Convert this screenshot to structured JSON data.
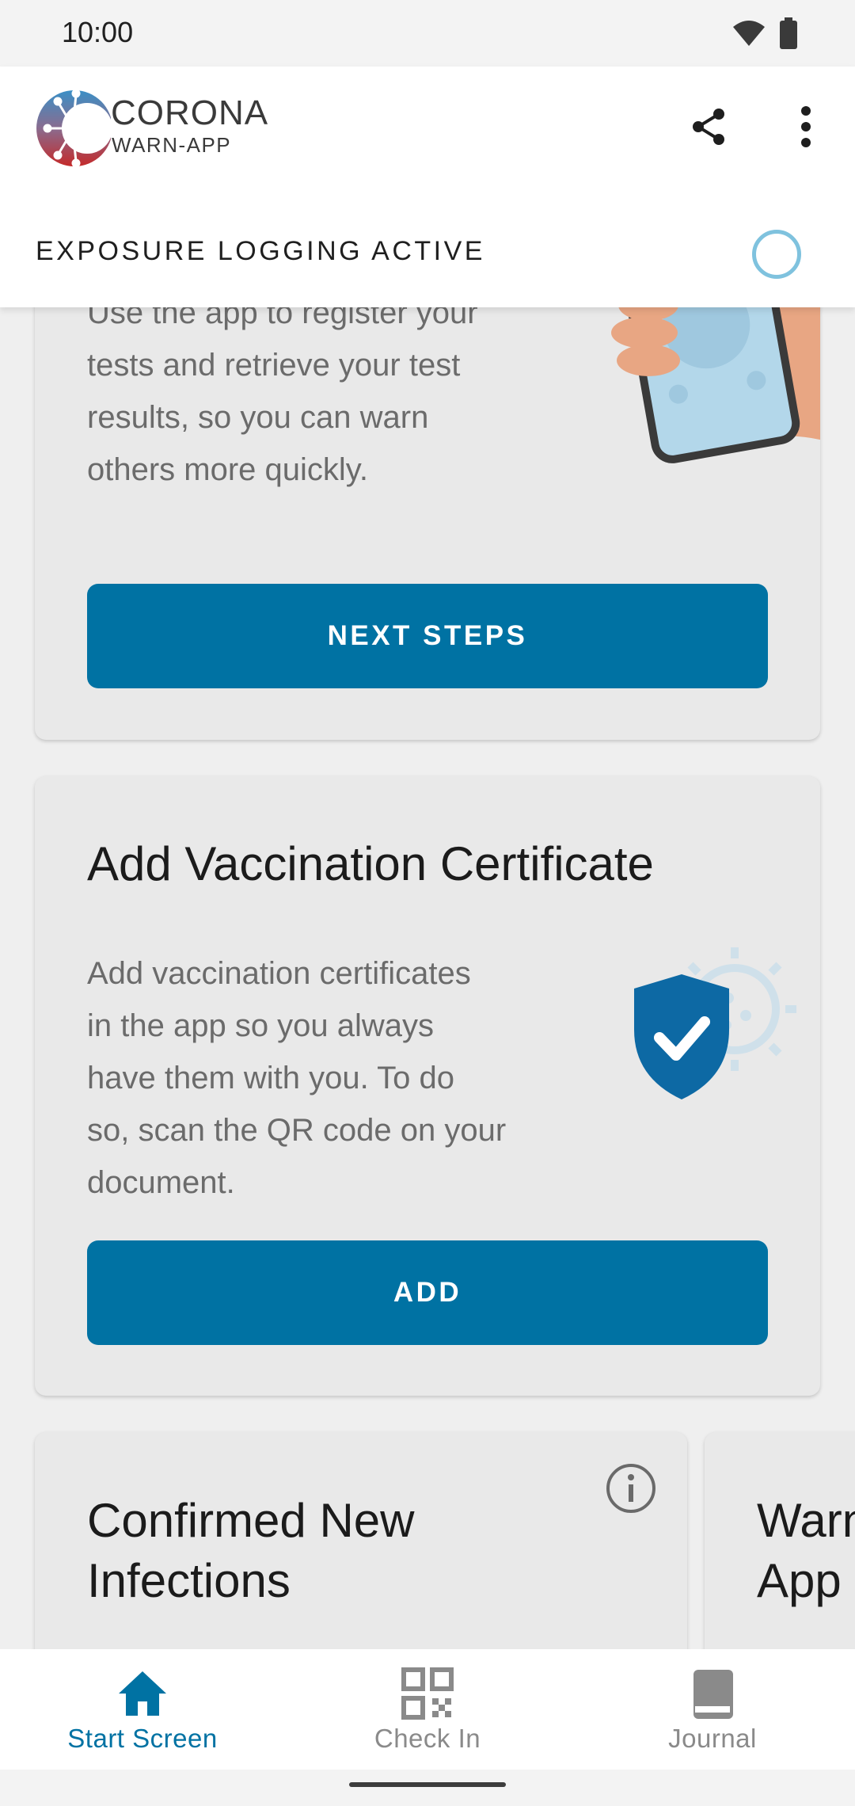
{
  "status_bar": {
    "time": "10:00",
    "icons": [
      "wifi-icon",
      "battery-icon"
    ]
  },
  "app_bar": {
    "brand_title": "CORONA",
    "brand_subtitle": "WARN-APP",
    "actions": [
      "share-icon",
      "more-vert-icon"
    ]
  },
  "exposure": {
    "label": "EXPOSURE LOGGING ACTIVE",
    "indicator_color": "#7fc2de"
  },
  "test_card": {
    "body": "Use the app to register your tests and retrieve your test results, so you can warn others more quickly.",
    "body_lines": [
      "Use the app to register your",
      "tests and retrieve your test",
      "results, so you can warn",
      "others more quickly."
    ],
    "button_label": "NEXT STEPS"
  },
  "vaccination_card": {
    "title": "Add Vaccination Certificate",
    "body_lines": [
      "Add vaccination certificates",
      "in the app so you always",
      "have them with you. To do",
      "so, scan the QR code on your",
      "document."
    ],
    "button_label": "ADD"
  },
  "infections_card": {
    "title_lines": [
      "Confirmed New",
      "Infections"
    ],
    "info_icon": "info-icon"
  },
  "next_card": {
    "title_lines": [
      "Warn",
      "App"
    ]
  },
  "bottom_nav": {
    "items": [
      {
        "label": "Start Screen",
        "icon": "home-icon",
        "active": true
      },
      {
        "label": "Check In",
        "icon": "qr-code-icon",
        "active": false
      },
      {
        "label": "Journal",
        "icon": "book-icon",
        "active": false
      }
    ]
  },
  "colors": {
    "primary": "#0072a3",
    "card_background": "#e9e9e9",
    "app_background": "#efefef"
  }
}
